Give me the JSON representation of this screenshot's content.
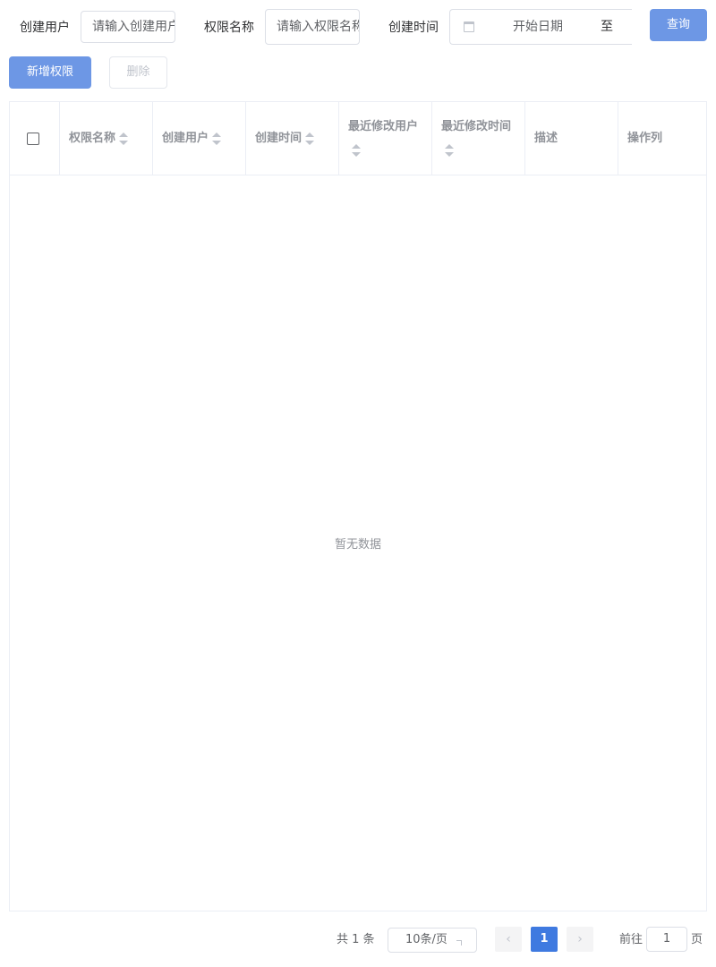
{
  "filters": {
    "creator_label": "创建用户",
    "creator_placeholder": "请输入创建用户",
    "perm_label": "权限名称",
    "perm_placeholder": "请输入权限名称",
    "time_label": "创建时间",
    "start_placeholder": "开始日期",
    "range_separator": "至",
    "query_label": "查询"
  },
  "actions": {
    "add_label": "新增权限",
    "delete_label": "删除"
  },
  "table": {
    "columns": [
      "权限名称",
      "创建用户",
      "创建时间",
      "最近修改用户",
      "最近修改时间",
      "描述",
      "操作列"
    ],
    "empty_text": "暂无数据"
  },
  "pagination": {
    "total_text": "共 1 条",
    "page_size": "10条/页",
    "current_page": "1",
    "goto_prefix": "前往",
    "goto_value": "1",
    "goto_suffix": "页"
  }
}
